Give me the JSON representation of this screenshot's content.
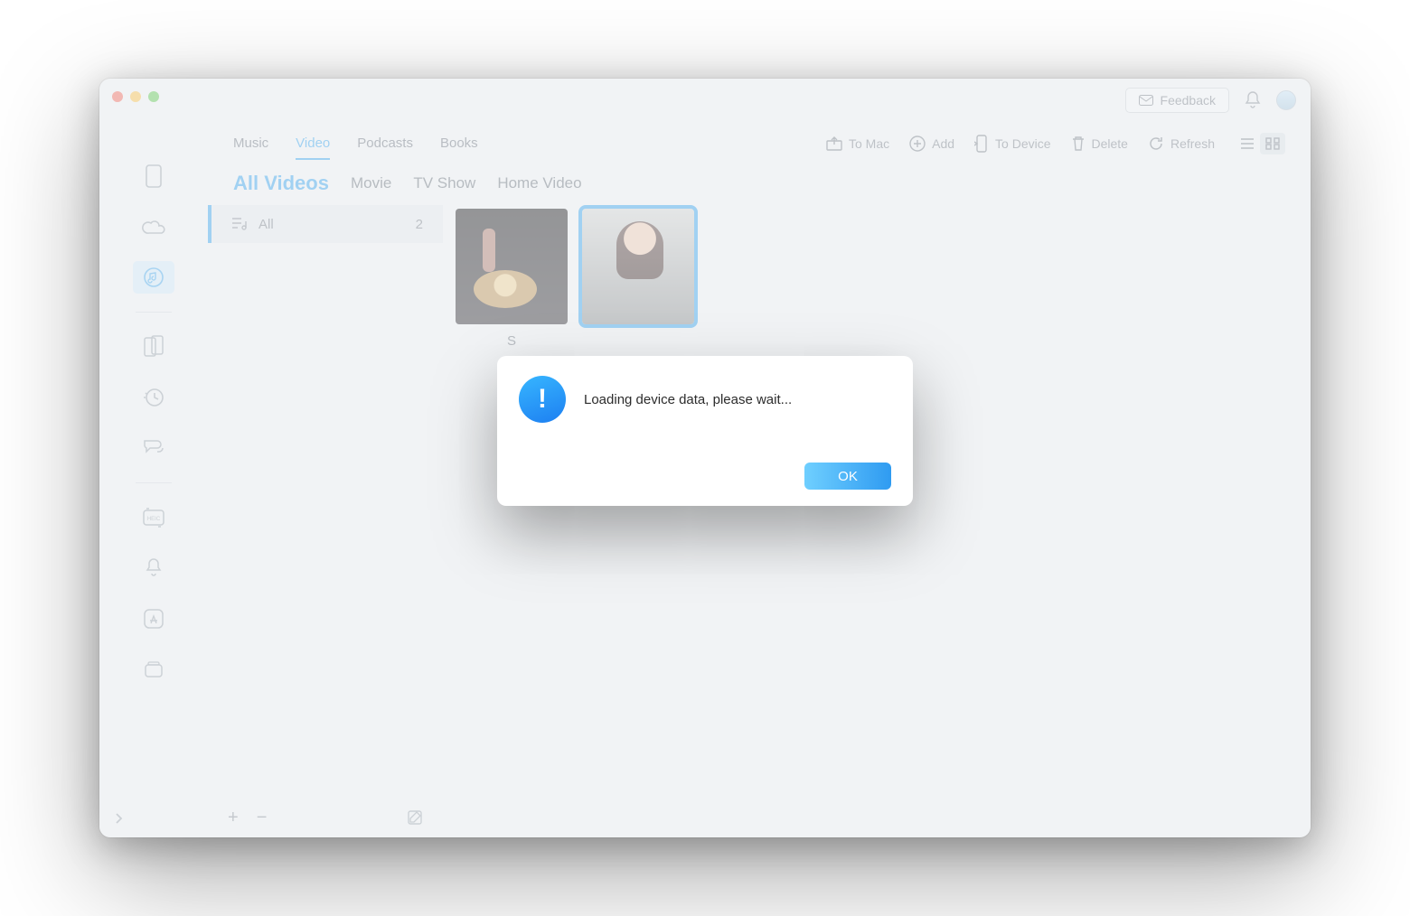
{
  "top_right": {
    "feedback_label": "Feedback"
  },
  "tabs": {
    "music": "Music",
    "video": "Video",
    "podcasts": "Podcasts",
    "books": "Books"
  },
  "toolbar": {
    "to_mac": "To Mac",
    "add": "Add",
    "to_device": "To Device",
    "delete": "Delete",
    "refresh": "Refresh"
  },
  "categories": {
    "all_videos": "All Videos",
    "movie": "Movie",
    "tv_show": "TV Show",
    "home_video": "Home Video"
  },
  "folders": {
    "all_label": "All",
    "all_count": "2"
  },
  "videos": {
    "item1_caption": "S"
  },
  "folder_footer": {
    "plus": "+",
    "minus": "−"
  },
  "modal": {
    "message": "Loading device data, please wait...",
    "ok_label": "OK"
  }
}
